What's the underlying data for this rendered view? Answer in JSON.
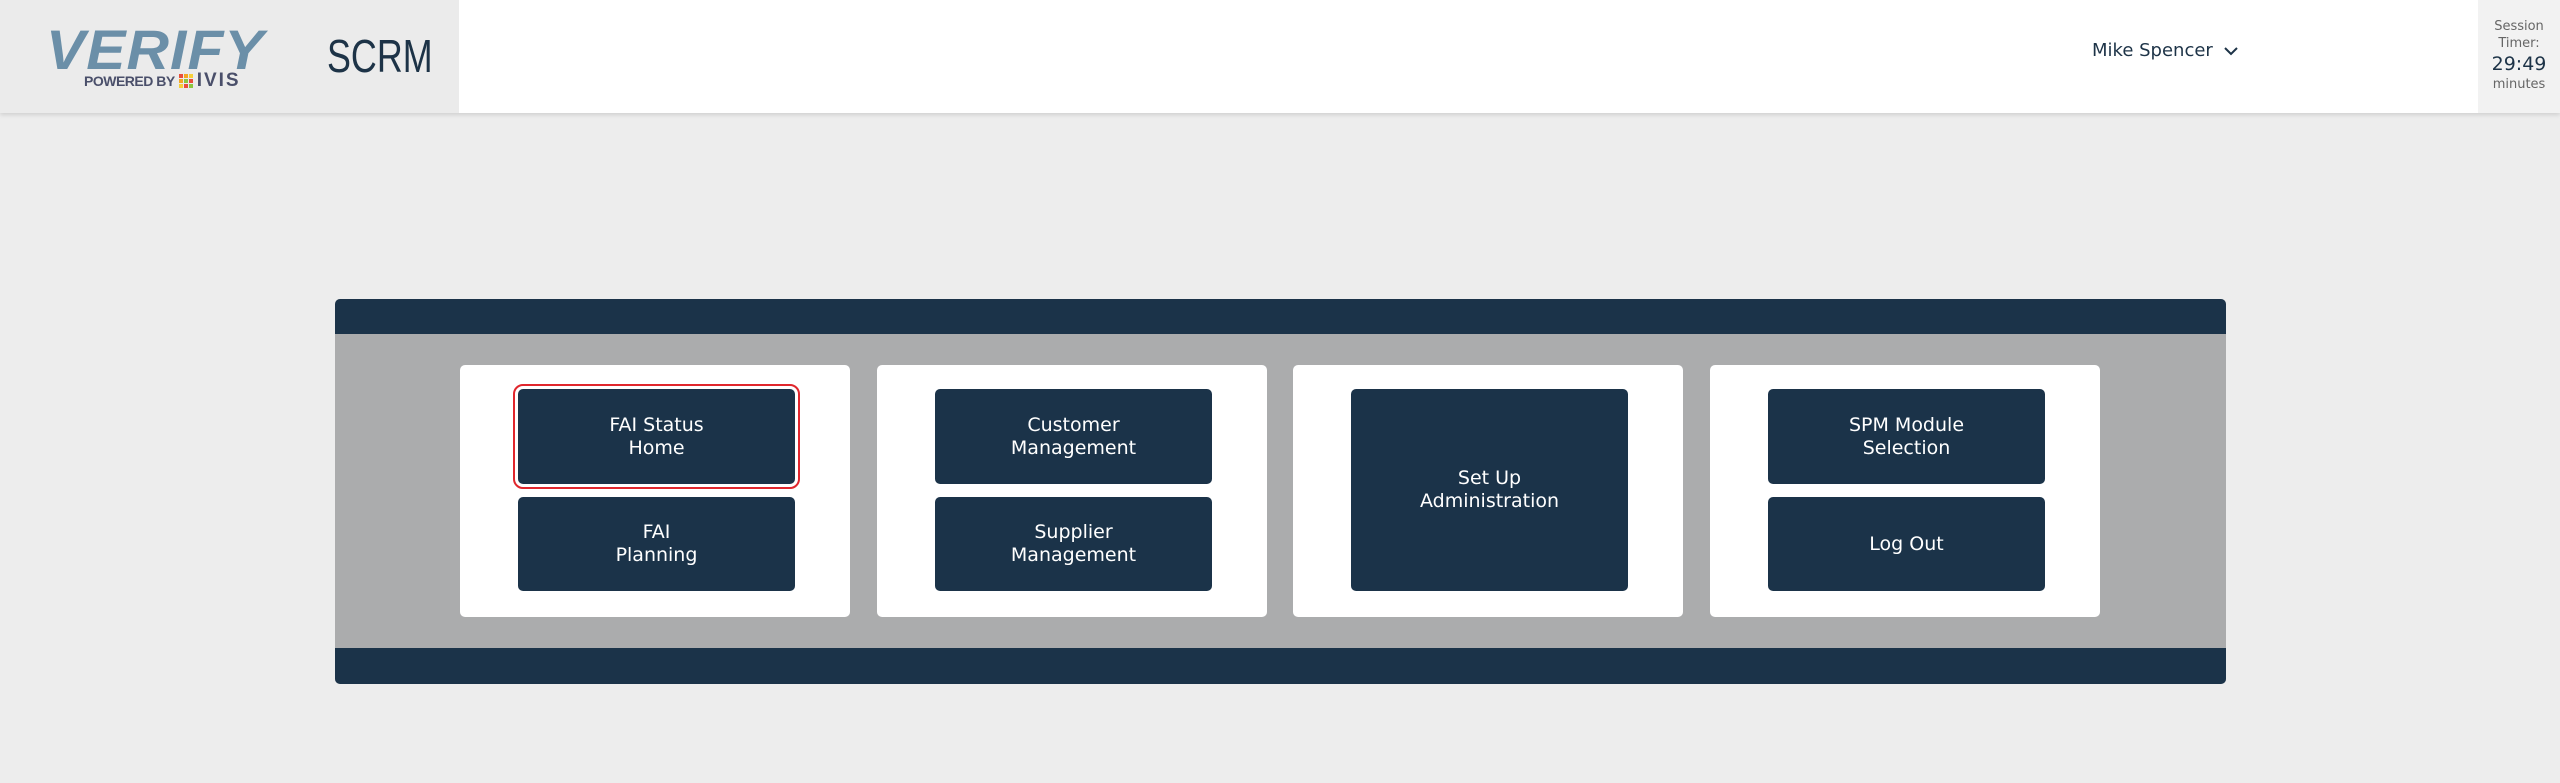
{
  "header": {
    "logo": {
      "word": "VERIFY",
      "powered_by": "POWERED BY",
      "brand": "IVIS"
    },
    "app_name": "SCRM",
    "user": {
      "name": "Mike Spencer",
      "icon": "chevron-down-icon"
    },
    "session_timer": {
      "label_line1": "Session",
      "label_line2": "Timer:",
      "value": "29:49",
      "unit": "minutes"
    }
  },
  "colors": {
    "navy": "#1b3349",
    "panel_gray": "#abacad",
    "focus_outline": "#e0262d",
    "logo_blue": "#6b8fa8"
  },
  "menu": {
    "cards": [
      {
        "buttons": [
          {
            "label": "FAI Status\nHome",
            "focused": true
          },
          {
            "label": "FAI\nPlanning"
          }
        ]
      },
      {
        "buttons": [
          {
            "label": "Customer\nManagement"
          },
          {
            "label": "Supplier\nManagement"
          }
        ]
      },
      {
        "buttons": [
          {
            "label": "Set Up\nAdministration"
          }
        ]
      },
      {
        "buttons": [
          {
            "label": "SPM Module\nSelection"
          },
          {
            "label": "Log Out"
          }
        ]
      }
    ]
  }
}
